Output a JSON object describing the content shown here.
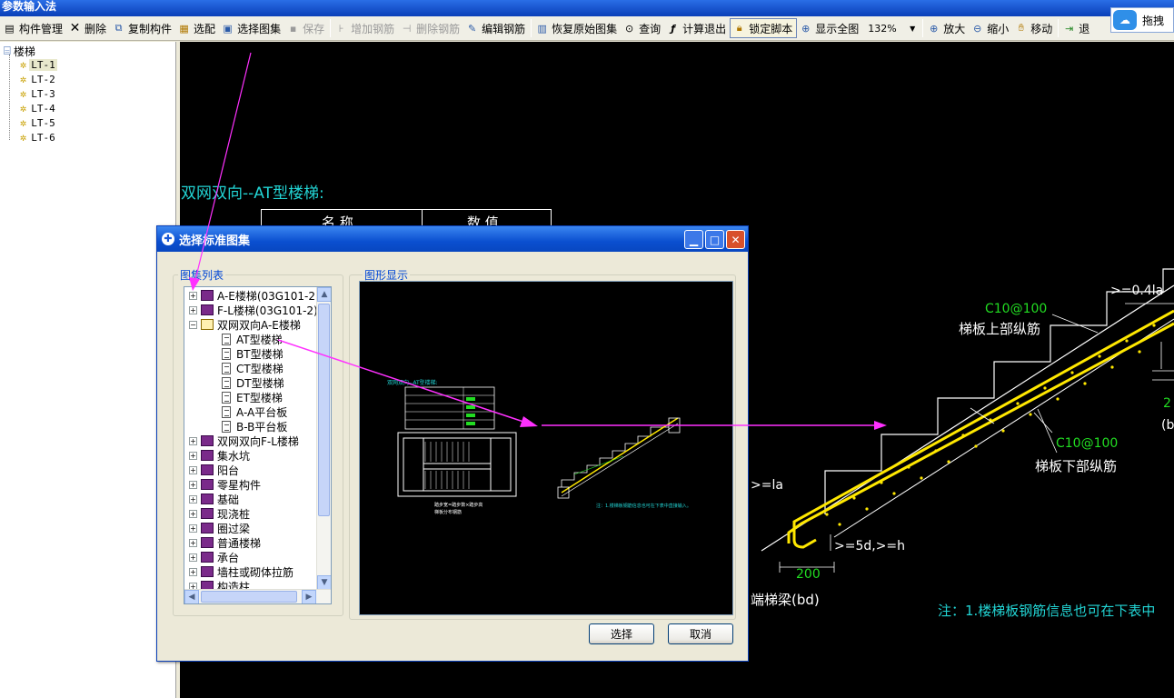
{
  "app": {
    "title": "参数输入法"
  },
  "toolbar": {
    "items": [
      {
        "label": "构件管理",
        "icon": "component-manage-icon",
        "state": "normal"
      },
      {
        "label": "删除",
        "icon": "delete-x-icon",
        "state": "normal"
      },
      {
        "label": "复制构件",
        "icon": "copy-icon",
        "state": "normal"
      },
      {
        "label": "选配",
        "icon": "select-config-icon",
        "state": "normal"
      },
      {
        "label": "选择图集",
        "icon": "atlas-icon",
        "state": "normal"
      },
      {
        "label": "保存",
        "icon": "save-icon",
        "state": "disabled"
      },
      {
        "label": "增加钢筋",
        "icon": "add-rebar-icon",
        "state": "disabled"
      },
      {
        "label": "删除钢筋",
        "icon": "remove-rebar-icon",
        "state": "disabled"
      },
      {
        "label": "编辑钢筋",
        "icon": "edit-rebar-icon",
        "state": "normal"
      },
      {
        "label": "恢复原始图集",
        "icon": "restore-icon",
        "state": "normal"
      },
      {
        "label": "查询",
        "icon": "binoculars-icon",
        "state": "normal"
      },
      {
        "label": "计算退出",
        "icon": "function-icon",
        "state": "normal"
      },
      {
        "label": "锁定脚本",
        "icon": "lock-icon",
        "state": "active"
      },
      {
        "label": "显示全图",
        "icon": "fit-view-icon",
        "state": "normal"
      }
    ],
    "zoom_value": "132%",
    "zoom_items": [
      {
        "label": "放大",
        "icon": "zoom-in-icon"
      },
      {
        "label": "缩小",
        "icon": "zoom-out-icon"
      },
      {
        "label": "移动",
        "icon": "hand-move-icon"
      }
    ],
    "last_label": "退",
    "corner_label": "拖拽"
  },
  "sidebar": {
    "root_label": "楼梯",
    "items": [
      "LT-1",
      "LT-2",
      "LT-3",
      "LT-4",
      "LT-5",
      "LT-6"
    ],
    "selected": "LT-1"
  },
  "canvas": {
    "title": "双网双向--AT型楼梯:",
    "table_headers": [
      "名 称",
      "数 值"
    ],
    "labels": {
      "top_rebar_spec": "C10@100",
      "top_rebar": "梯板上部纵筋",
      "bottom_rebar_spec": "C10@100",
      "bottom_rebar": "梯板下部纵筋",
      "anchor_top": ">=0.4la",
      "anchor_la": ">=la",
      "anchor_5d": ">=5d,>=h",
      "dim_200": "200",
      "beam": "端梯梁(bd)",
      "note": "注：1.楼梯板钢筋信息也可在下表中",
      "right_2": "2",
      "right_b": "(b"
    }
  },
  "dialog": {
    "title": "选择标准图集",
    "list_group_label": "图集列表",
    "preview_group_label": "图形显示",
    "tree": [
      {
        "label": "A-E楼梯(03G101-2)",
        "level": 0,
        "kind": "book",
        "expanded": false
      },
      {
        "label": "F-L楼梯(03G101-2)",
        "level": 0,
        "kind": "book",
        "expanded": false
      },
      {
        "label": "双网双向A-E楼梯",
        "level": 0,
        "kind": "book-open",
        "expanded": true
      },
      {
        "label": "AT型楼梯",
        "level": 1,
        "kind": "doc"
      },
      {
        "label": "BT型楼梯",
        "level": 1,
        "kind": "doc"
      },
      {
        "label": "CT型楼梯",
        "level": 1,
        "kind": "doc"
      },
      {
        "label": "DT型楼梯",
        "level": 1,
        "kind": "doc"
      },
      {
        "label": "ET型楼梯",
        "level": 1,
        "kind": "doc"
      },
      {
        "label": "A-A平台板",
        "level": 1,
        "kind": "doc"
      },
      {
        "label": "B-B平台板",
        "level": 1,
        "kind": "doc"
      },
      {
        "label": "双网双向F-L楼梯",
        "level": 0,
        "kind": "book",
        "expanded": false
      },
      {
        "label": "集水坑",
        "level": 0,
        "kind": "book",
        "expanded": false
      },
      {
        "label": "阳台",
        "level": 0,
        "kind": "book",
        "expanded": false
      },
      {
        "label": "零星构件",
        "level": 0,
        "kind": "book",
        "expanded": false
      },
      {
        "label": "基础",
        "level": 0,
        "kind": "book",
        "expanded": false
      },
      {
        "label": "现浇桩",
        "level": 0,
        "kind": "book",
        "expanded": false
      },
      {
        "label": "圈过梁",
        "level": 0,
        "kind": "book",
        "expanded": false
      },
      {
        "label": "普通楼梯",
        "level": 0,
        "kind": "book",
        "expanded": false
      },
      {
        "label": "承台",
        "level": 0,
        "kind": "book",
        "expanded": false
      },
      {
        "label": "墙柱或砌体拉筋",
        "level": 0,
        "kind": "book",
        "expanded": false
      },
      {
        "label": "构造柱",
        "level": 0,
        "kind": "book",
        "expanded": false
      }
    ],
    "ok_label": "选择",
    "cancel_label": "取消",
    "preview": {
      "title": "双网双向--AT型楼梯:",
      "note": "注：1.楼梯板钢筋信息也可在下表中直接输入。",
      "bottom_left_a": "踏步宽=踏步数×踏步高",
      "bottom_left_b": "梯板分布钢筋"
    }
  },
  "colors": {
    "cad_cyan": "#22d4d4",
    "cad_yellow": "#ffe800",
    "cad_green": "#22dd22",
    "annotation_magenta": "#ff30ff",
    "xp_blue": "#0a4fd0"
  }
}
